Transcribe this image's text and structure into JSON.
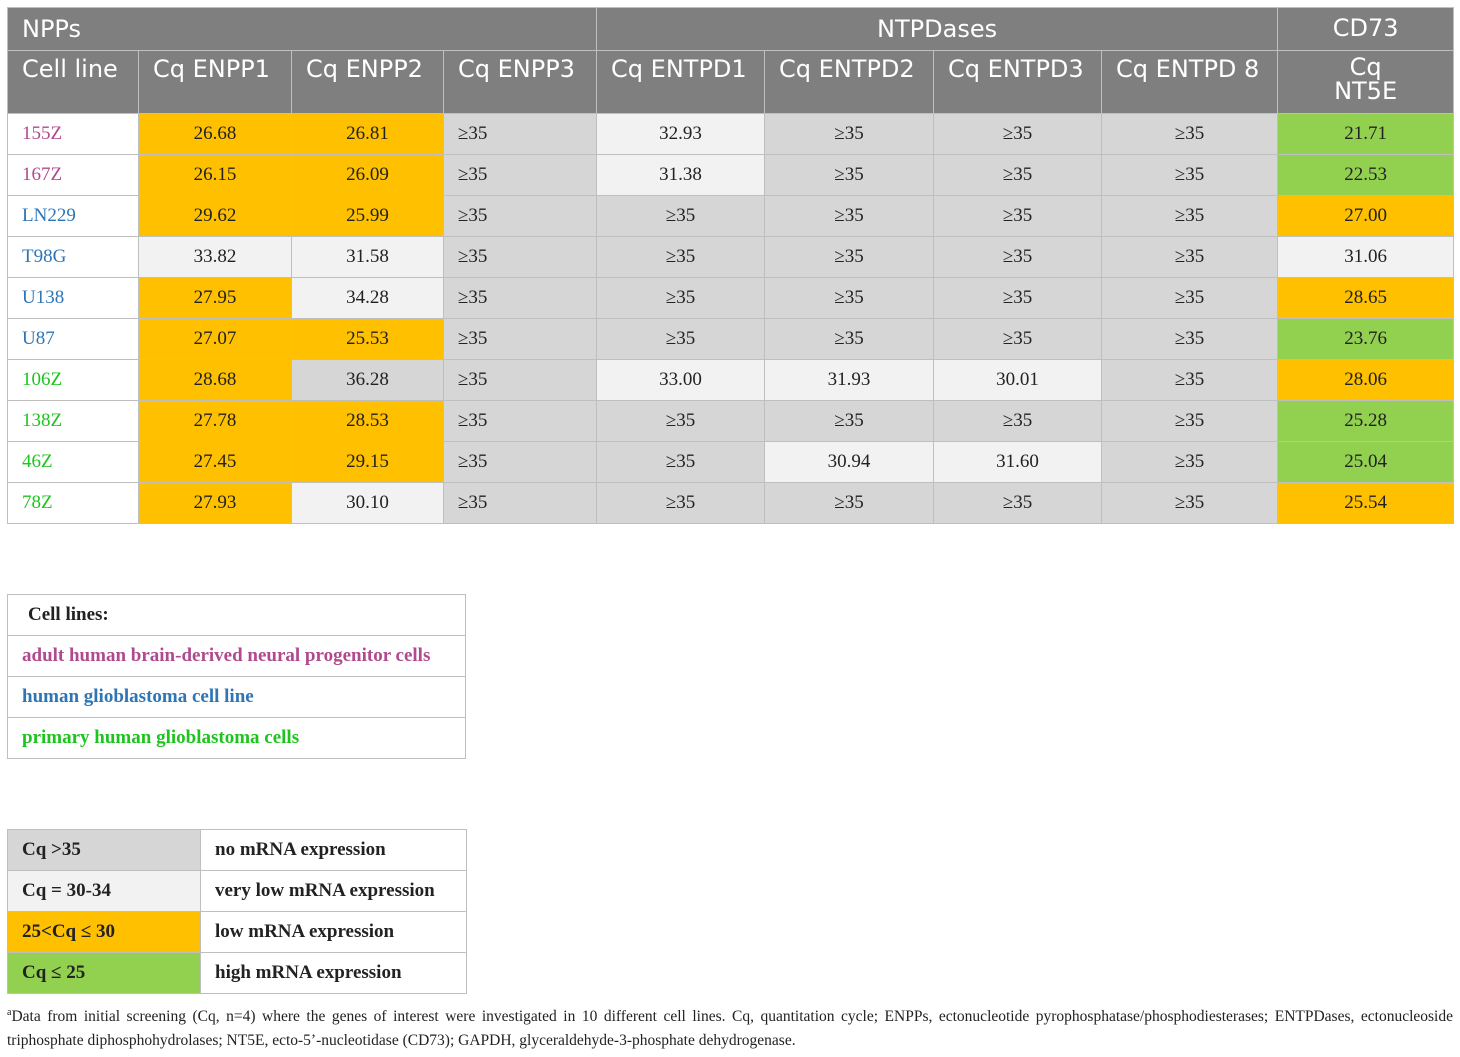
{
  "table": {
    "groups": {
      "npps": "NPPs",
      "ntpdases": "NTPDases",
      "cd73": "CD73"
    },
    "columns": {
      "cell_line": "Cell line",
      "enpp1": "Cq ENPP1",
      "enpp2": "Cq ENPP2",
      "enpp3": "Cq ENPP3",
      "entpd1": "Cq ENTPD1",
      "entpd2": "Cq ENTPD2",
      "entpd3": "Cq ENTPD3",
      "entpd8": "Cq ENTPD 8",
      "nt5e_line1": "Cq",
      "nt5e_line2": "NT5E"
    },
    "rows": [
      {
        "name": "155Z",
        "cells": [
          "26.68",
          "26.81",
          "≥35",
          "32.93",
          "≥35",
          "≥35",
          "≥35",
          "21.71"
        ]
      },
      {
        "name": "167Z",
        "cells": [
          "26.15",
          "26.09",
          "≥35",
          "31.38",
          "≥35",
          "≥35",
          "≥35",
          "22.53"
        ]
      },
      {
        "name": "LN229",
        "cells": [
          "29.62",
          "25.99",
          "≥35",
          "≥35",
          "≥35",
          "≥35",
          "≥35",
          "27.00"
        ]
      },
      {
        "name": "T98G",
        "cells": [
          "33.82",
          "31.58",
          "≥35",
          "≥35",
          "≥35",
          "≥35",
          "≥35",
          "31.06"
        ]
      },
      {
        "name": "U138",
        "cells": [
          "27.95",
          "34.28",
          "≥35",
          "≥35",
          "≥35",
          "≥35",
          "≥35",
          "28.65"
        ]
      },
      {
        "name": "U87",
        "cells": [
          "27.07",
          "25.53",
          "≥35",
          "≥35",
          "≥35",
          "≥35",
          "≥35",
          "23.76"
        ]
      },
      {
        "name": "106Z",
        "cells": [
          "28.68",
          "36.28",
          "≥35",
          "33.00",
          "31.93",
          "30.01",
          "≥35",
          "28.06"
        ]
      },
      {
        "name": "138Z",
        "cells": [
          "27.78",
          "28.53",
          "≥35",
          "≥35",
          "≥35",
          "≥35",
          "≥35",
          "25.28"
        ]
      },
      {
        "name": "46Z",
        "cells": [
          "27.45",
          "29.15",
          "≥35",
          "≥35",
          "30.94",
          "31.60",
          "≥35",
          "25.04"
        ]
      },
      {
        "name": "78Z",
        "cells": [
          "27.93",
          "30.10",
          "≥35",
          "≥35",
          "≥35",
          "≥35",
          "≥35",
          "25.54"
        ]
      }
    ]
  },
  "cell_lines_legend": {
    "title": "Cell lines:",
    "items": [
      "adult human brain-derived neural progenitor cells",
      "human glioblastoma cell line",
      "primary human glioblastoma cells"
    ]
  },
  "cq_legend": [
    {
      "range": "Cq >35",
      "meaning": "no mRNA expression"
    },
    {
      "range": "Cq = 30-34",
      "meaning": "very low mRNA expression"
    },
    {
      "range": "25<Cq ≤ 30",
      "meaning": "low mRNA expression"
    },
    {
      "range": "Cq ≤ 25",
      "meaning": "high mRNA expression"
    }
  ],
  "colors": {
    "none": "#d6d6d6",
    "very_low": "#f2f2f2",
    "low": "#ffc000",
    "high": "#92d050",
    "header": "#7f7f7f",
    "purple_text": "#b04a8e",
    "blue_text": "#2e75b6",
    "green_text": "#1ec41e"
  },
  "footnote": {
    "marker": "a",
    "text": "Data from initial screening (Cq, n=4) where the genes of interest were investigated in 10 different cell lines. Cq, quantitation cycle; ENPPs, ectonucleotide pyrophosphatase/phosphodiesterases; ENTPDases, ectonucleoside triphosphate diphosphohydrolases; NT5E, ecto-5’-nucleotidase (CD73); GAPDH, glyceraldehyde-3-phosphate dehydrogenase."
  }
}
